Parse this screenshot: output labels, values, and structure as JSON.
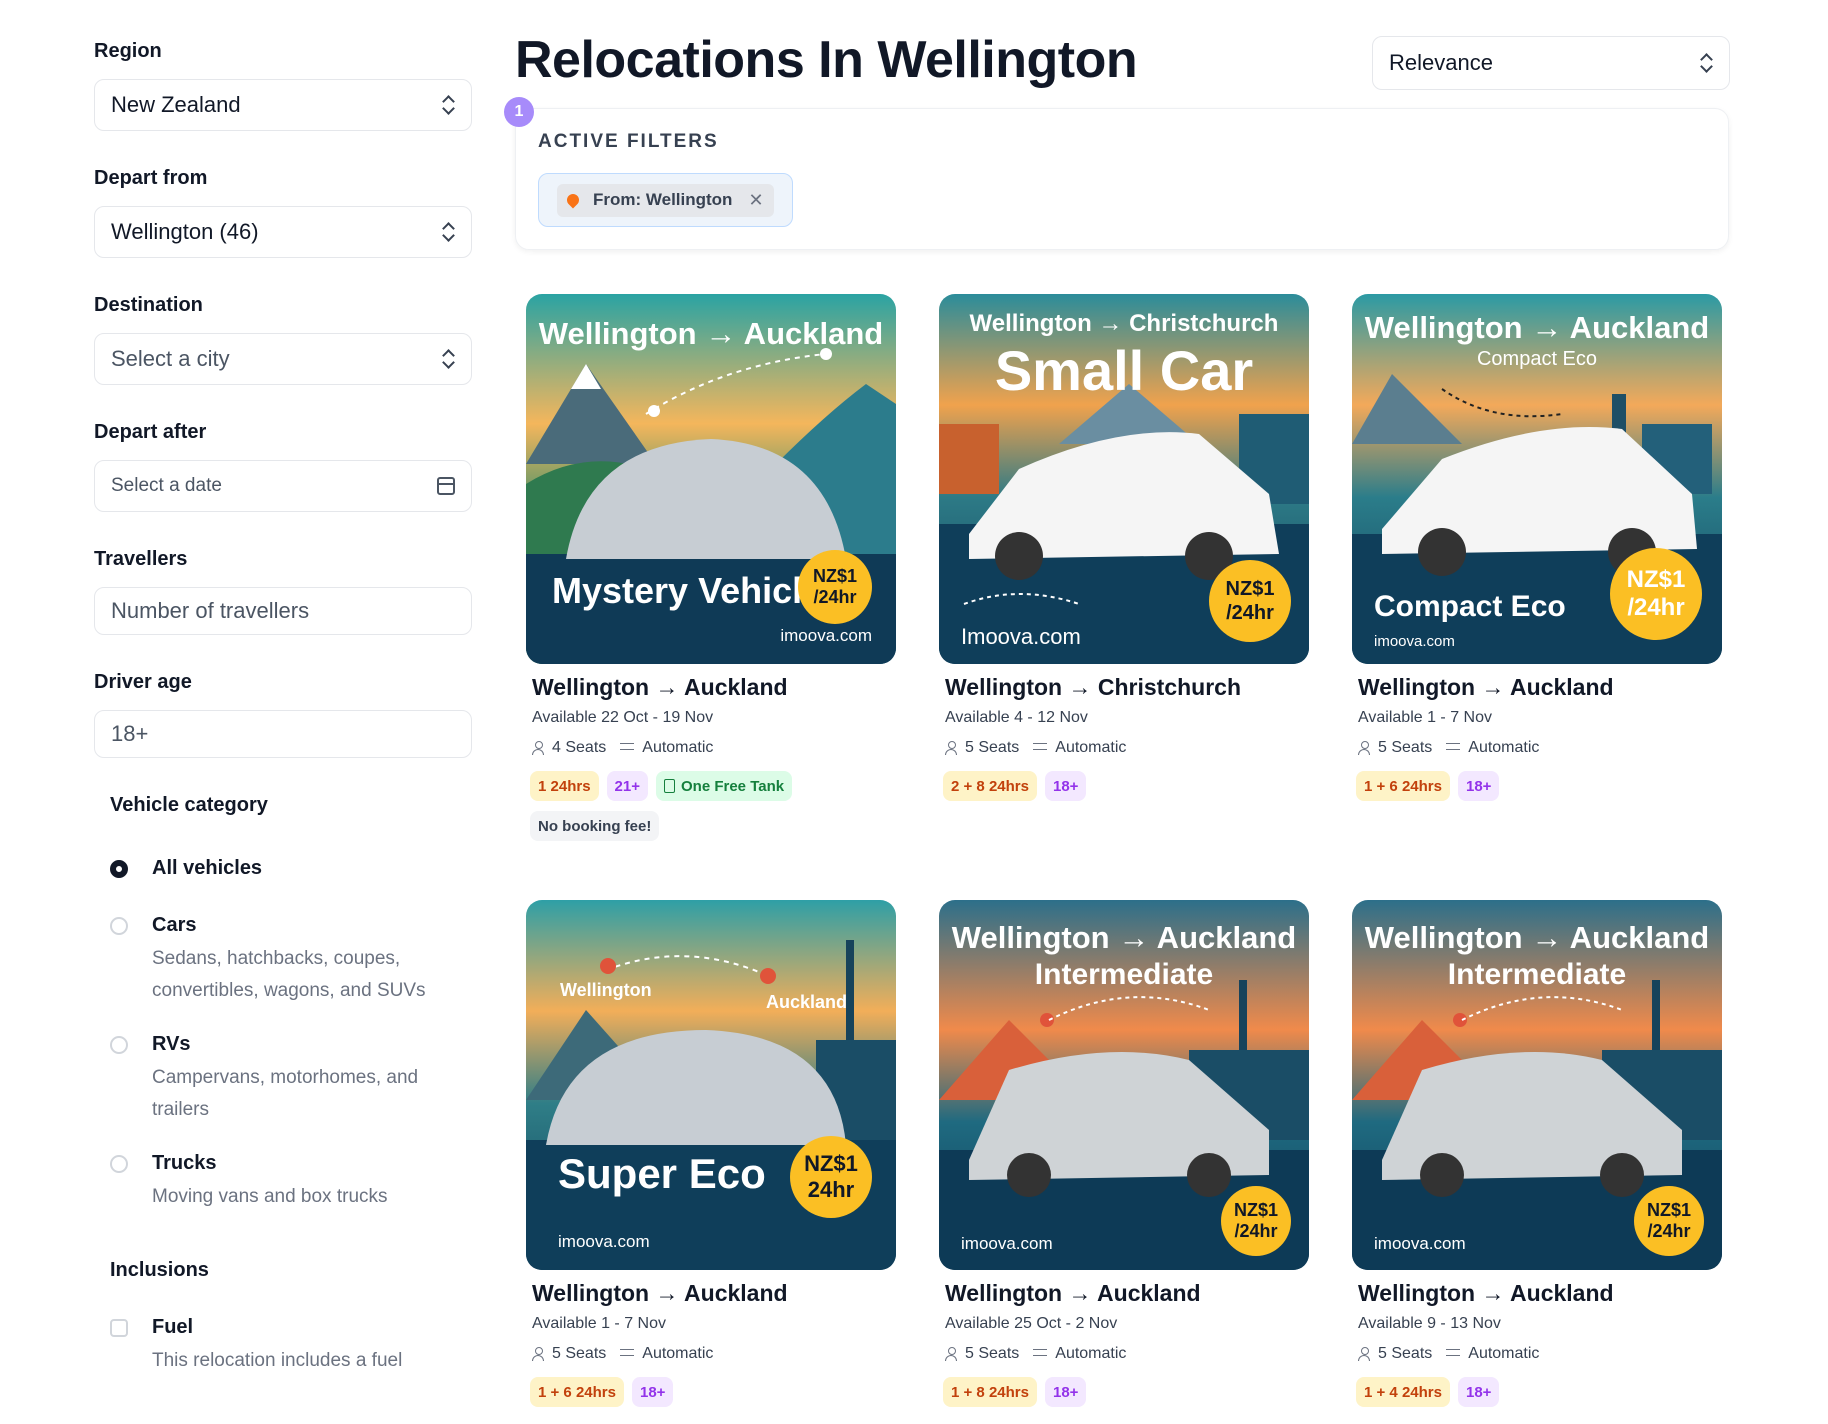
{
  "sidebar": {
    "region": {
      "label": "Region",
      "value": "New Zealand"
    },
    "depart_from": {
      "label": "Depart from",
      "value": "Wellington (46)"
    },
    "destination": {
      "label": "Destination",
      "placeholder": "Select a city"
    },
    "depart_after": {
      "label": "Depart after",
      "placeholder": "Select a date"
    },
    "travellers": {
      "label": "Travellers",
      "placeholder": "Number of travellers"
    },
    "driver_age": {
      "label": "Driver age",
      "value": "18+"
    },
    "vehicle_category": {
      "title": "Vehicle category",
      "options": [
        {
          "label": "All vehicles",
          "description": "",
          "selected": true
        },
        {
          "label": "Cars",
          "description": "Sedans, hatchbacks, coupes, convertibles, wagons, and SUVs",
          "selected": false
        },
        {
          "label": "RVs",
          "description": "Campervans, motorhomes, and trailers",
          "selected": false
        },
        {
          "label": "Trucks",
          "description": "Moving vans and box trucks",
          "selected": false
        }
      ]
    },
    "inclusions": {
      "title": "Inclusions",
      "options": [
        {
          "label": "Fuel",
          "description": "This relocation includes a fuel",
          "checked": false
        }
      ]
    }
  },
  "header": {
    "title": "Relocations In Wellington",
    "sort": "Relevance"
  },
  "active_filters": {
    "count": "1",
    "title": "ACTIVE FILTERS",
    "chips": [
      {
        "label": "From: Wellington"
      }
    ]
  },
  "listings": [
    {
      "image": {
        "route": "Wellington → Auckland",
        "subtitle": "",
        "model": "Mystery Vehicl",
        "brand": "imoova.com",
        "price_top": "NZ$1",
        "price_bottom": "/24hr"
      },
      "title": "Wellington → Auckland",
      "dates": "Available 22 Oct - 19 Nov",
      "seats": "4 Seats",
      "transmission": "Automatic",
      "tags": [
        {
          "text": "1 24hrs",
          "style": "orange"
        },
        {
          "text": "21+",
          "style": "purple"
        },
        {
          "text": "One Free Tank",
          "style": "green"
        },
        {
          "text": "No booking fee!",
          "style": "gray"
        }
      ]
    },
    {
      "image": {
        "route": "Wellington → Christchurch",
        "subtitle": "Small Car",
        "model": "",
        "brand": "Imoova.com",
        "price_top": "NZ$1",
        "price_bottom": "/24hr"
      },
      "title": "Wellington → Christchurch",
      "dates": "Available 4 - 12 Nov",
      "seats": "5 Seats",
      "transmission": "Automatic",
      "tags": [
        {
          "text": "2 + 8 24hrs",
          "style": "orange"
        },
        {
          "text": "18+",
          "style": "purple"
        }
      ]
    },
    {
      "image": {
        "route": "Wellington → Auckland",
        "subtitle": "Compact Eco",
        "model": "Compact Eco",
        "brand": "imoova.com",
        "price_top": "NZ$1",
        "price_bottom": "/24hr"
      },
      "title": "Wellington → Auckland",
      "dates": "Available 1 - 7 Nov",
      "seats": "5 Seats",
      "transmission": "Automatic",
      "tags": [
        {
          "text": "1 + 6 24hrs",
          "style": "orange"
        },
        {
          "text": "18+",
          "style": "purple"
        }
      ]
    },
    {
      "image": {
        "route": "",
        "subtitle": "",
        "model": "Super Eco",
        "brand": "imoova.com",
        "price_top": "NZ$1",
        "price_bottom": "24hr",
        "from_city": "Wellington",
        "to_city": "Auckland"
      },
      "title": "Wellington → Auckland",
      "dates": "Available 1 - 7 Nov",
      "seats": "5 Seats",
      "transmission": "Automatic",
      "tags": [
        {
          "text": "1 + 6 24hrs",
          "style": "orange"
        },
        {
          "text": "18+",
          "style": "purple"
        }
      ]
    },
    {
      "image": {
        "route": "Wellington → Auckland",
        "subtitle": "Intermediate",
        "model": "",
        "brand": "imoova.com",
        "price_top": "NZ$1",
        "price_bottom": "/24hr"
      },
      "title": "Wellington → Auckland",
      "dates": "Available 25 Oct - 2 Nov",
      "seats": "5 Seats",
      "transmission": "Automatic",
      "tags": [
        {
          "text": "1 + 8 24hrs",
          "style": "orange"
        },
        {
          "text": "18+",
          "style": "purple"
        }
      ]
    },
    {
      "image": {
        "route": "Wellington → Auckland",
        "subtitle": "Intermediate",
        "model": "",
        "brand": "imoova.com",
        "price_top": "NZ$1",
        "price_bottom": "/24hr"
      },
      "title": "Wellington → Auckland",
      "dates": "Available 9 - 13 Nov",
      "seats": "5 Seats",
      "transmission": "Automatic",
      "tags": [
        {
          "text": "1 + 4 24hrs",
          "style": "orange"
        },
        {
          "text": "18+",
          "style": "purple"
        }
      ]
    }
  ],
  "colors": {
    "accent_purple": "#a78bfa",
    "price_badge": "#fbbf24",
    "tag_orange_text": "#c2410c",
    "tag_purple_text": "#9333ea",
    "tag_green_text": "#15803d"
  }
}
